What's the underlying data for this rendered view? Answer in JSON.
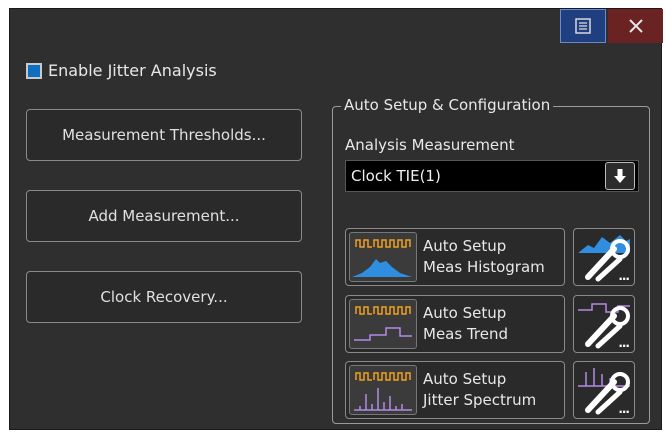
{
  "enable": {
    "label": "Enable Jitter Analysis",
    "checked": true
  },
  "left_buttons": {
    "thresholds": "Measurement Thresholds...",
    "add_measurement": "Add Measurement...",
    "clock_recovery": "Clock Recovery..."
  },
  "group": {
    "title": "Auto Setup & Configuration",
    "analysis_label": "Analysis Measurement",
    "analysis_value": "Clock TIE(1)",
    "auto_buttons": [
      {
        "line1": "Auto Setup",
        "line2": "Meas Histogram",
        "icon": "histogram-icon"
      },
      {
        "line1": "Auto Setup",
        "line2": "Meas Trend",
        "icon": "trend-icon"
      },
      {
        "line1": "Auto Setup",
        "line2": "Jitter Spectrum",
        "icon": "spectrum-icon"
      }
    ],
    "config_ellipsis": "..."
  },
  "colors": {
    "accent": "#0e6fc2",
    "histogram": "#2f8ee0",
    "trend_spectrum": "#b489e6",
    "waveform": "#f0a020"
  }
}
